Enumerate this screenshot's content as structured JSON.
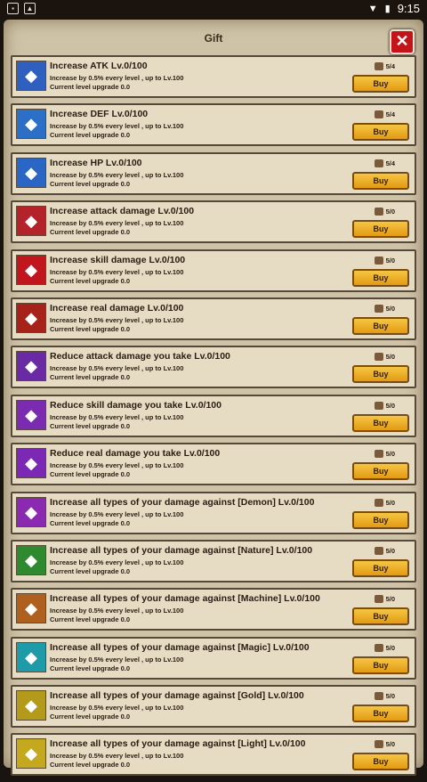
{
  "status_bar": {
    "time": "9:15"
  },
  "dialog": {
    "title": "Gift",
    "close_glyph": "✕",
    "buy_label": "Buy",
    "items": [
      {
        "name": "Increase ATK Lv.0/100",
        "desc": "Increase by 0.5% every level , up to Lv.100",
        "current": "Current level upgrade 0.0",
        "cost": "5/4",
        "icon": "trident-icon",
        "color": "#2f5fbf"
      },
      {
        "name": "Increase DEF Lv.0/100",
        "desc": "Increase by 0.5% every level , up to Lv.100",
        "current": "Current level upgrade 0.0",
        "cost": "5/4",
        "icon": "shield-figure-icon",
        "color": "#2c6fc7"
      },
      {
        "name": "Increase HP Lv.0/100",
        "desc": "Increase by 0.5% every level , up to Lv.100",
        "current": "Current level upgrade 0.0",
        "cost": "5/4",
        "icon": "heal-cross-icon",
        "color": "#2a66c4"
      },
      {
        "name": "Increase attack damage Lv.0/100",
        "desc": "Increase by 0.5% every level , up to Lv.100",
        "current": "Current level upgrade 0.0",
        "cost": "5/0",
        "icon": "sword-icon",
        "color": "#b4232a"
      },
      {
        "name": "Increase skill damage Lv.0/100",
        "desc": "Increase by 0.5% every level , up to Lv.100",
        "current": "Current level upgrade 0.0",
        "cost": "5/0",
        "icon": "skill-slash-icon",
        "color": "#c2161f"
      },
      {
        "name": "Increase real damage Lv.0/100",
        "desc": "Increase by 0.5% every level , up to Lv.100",
        "current": "Current level upgrade 0.0",
        "cost": "5/0",
        "icon": "blast-icon",
        "color": "#a8221c"
      },
      {
        "name": "Reduce attack damage you take Lv.0/100",
        "desc": "Increase by 0.5% every level , up to Lv.100",
        "current": "Current level upgrade 0.0",
        "cost": "5/0",
        "icon": "guard-icon",
        "color": "#6a2aa3"
      },
      {
        "name": "Reduce skill damage you take Lv.0/100",
        "desc": "Increase by 0.5% every level , up to Lv.100",
        "current": "Current level upgrade 0.0",
        "cost": "5/0",
        "icon": "spellbook-icon",
        "color": "#7a2bb0"
      },
      {
        "name": "Reduce real damage you take Lv.0/100",
        "desc": "Increase by 0.5% every level , up to Lv.100",
        "current": "Current level upgrade 0.0",
        "cost": "5/0",
        "icon": "aura-icon",
        "color": "#7b28b4"
      },
      {
        "name": "Increase all types of your damage against [Demon] Lv.0/100",
        "desc": "Increase by 0.5% every level , up to Lv.100",
        "current": "Current level upgrade 0.0",
        "cost": "5/0",
        "icon": "demon-warrior-icon",
        "color": "#8a2ab0"
      },
      {
        "name": "Increase all types of your damage against [Nature] Lv.0/100",
        "desc": "Increase by 0.5% every level , up to Lv.100",
        "current": "Current level upgrade 0.0",
        "cost": "5/0",
        "icon": "nature-warrior-icon",
        "color": "#2f8a2f"
      },
      {
        "name": "Increase all types of your damage against [Machine] Lv.0/100",
        "desc": "Increase by 0.5% every level , up to Lv.100",
        "current": "Current level upgrade 0.0",
        "cost": "5/0",
        "icon": "machine-warrior-icon",
        "color": "#b0601e"
      },
      {
        "name": "Increase all types of your damage against [Magic] Lv.0/100",
        "desc": "Increase by 0.5% every level , up to Lv.100",
        "current": "Current level upgrade 0.0",
        "cost": "5/0",
        "icon": "magic-warrior-icon",
        "color": "#1f9aa8"
      },
      {
        "name": "Increase all types of your damage against [Gold] Lv.0/100",
        "desc": "Increase by 0.5% every level , up to Lv.100",
        "current": "Current level upgrade 0.0",
        "cost": "5/0",
        "icon": "gold-warrior-icon",
        "color": "#b49a1a"
      },
      {
        "name": "Increase all types of your damage against [Light] Lv.0/100",
        "desc": "Increase by 0.5% every level , up to Lv.100",
        "current": "Current level upgrade 0.0",
        "cost": "5/0",
        "icon": "light-warrior-icon",
        "color": "#c4a81e"
      }
    ]
  }
}
